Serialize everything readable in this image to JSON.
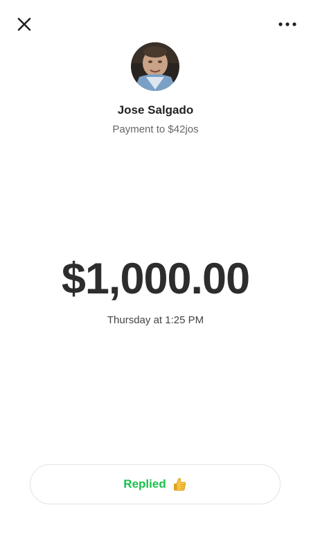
{
  "header": {
    "close_icon": "close-icon",
    "more_icon": "more-horizontal-icon"
  },
  "recipient": {
    "name": "Jose Salgado",
    "subtitle": "Payment to $42jos"
  },
  "payment": {
    "amount": "$1,000.00",
    "timestamp": "Thursday at 1:25 PM"
  },
  "reply_button": {
    "label": "Replied",
    "emoji_icon": "thumbs-up-icon"
  },
  "colors": {
    "accent_green": "#18c14b",
    "amount_text": "#2d2d2d"
  }
}
